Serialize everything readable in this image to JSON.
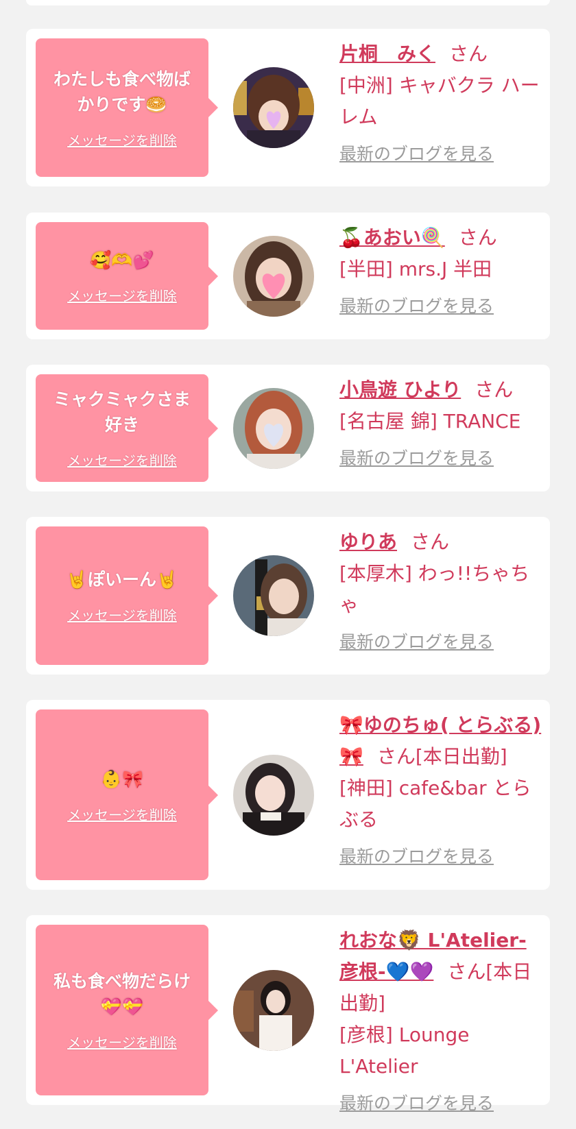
{
  "delete_label": "メッセージを削除",
  "blog_label": "最新のブログを見る",
  "cards": [
    {
      "message": "わたしも食べ物ばかりです🥯",
      "name": "片桐　みく",
      "suffix": "さん",
      "shop": "[中洲] キャバクラ ハーレム"
    },
    {
      "message": "🥰🫶💕",
      "name": "🍒あおい🍭",
      "suffix": "さん",
      "shop": "[半田] mrs.J 半田"
    },
    {
      "message": "ミャクミャクさま好き",
      "name": "小鳥遊 ひより",
      "suffix": "さん",
      "shop": "[名古屋 錦] TRANCE"
    },
    {
      "message": "🤘ぽいーん🤘",
      "name": "ゆりあ",
      "suffix": "さん",
      "shop": "[本厚木] わっ!!ちゃちゃ"
    },
    {
      "message": "👶🎀",
      "name": "🎀ゆのちゅ( とらぶる)🎀",
      "suffix": "さん[本日出勤]",
      "shop": "[神田] cafe&bar とらぶる"
    },
    {
      "message": "私も食べ物だらけ💝💝",
      "name": "れおな🦁 L'Atelier-彦根-💙💜",
      "suffix": "さん[本日出勤]",
      "shop": "[彦根] Lounge L'Atelier"
    }
  ],
  "colors": {
    "page_bg": "#f2f2f2",
    "bubble_bg": "#ff93a3",
    "name_color": "#d03a5b",
    "blog_link_color": "#9b9b9b"
  }
}
